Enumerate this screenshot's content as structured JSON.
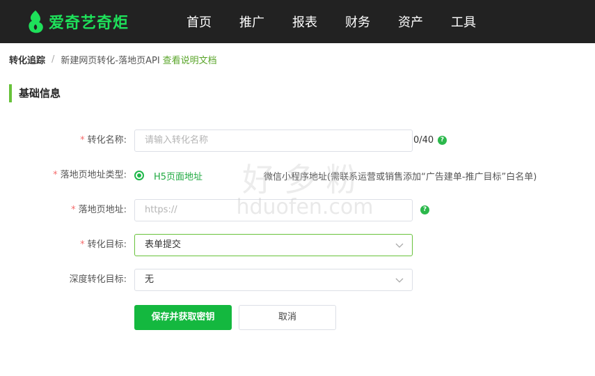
{
  "header": {
    "brand": "爱奇艺奇炬",
    "nav": [
      "首页",
      "推广",
      "报表",
      "财务",
      "资产",
      "工具"
    ]
  },
  "breadcrumb": {
    "root": "转化追踪",
    "separator": "/",
    "current": "新建网页转化-落地页API",
    "doc_link": "查看说明文档"
  },
  "section": {
    "title": "基础信息"
  },
  "form": {
    "name": {
      "label": "转化名称:",
      "placeholder": "请输入转化名称",
      "counter": "0/40"
    },
    "landing_type": {
      "label": "落地页地址类型:",
      "selected": "H5页面地址",
      "other": "微信小程序地址(需联系运营或销售添加“广告建单-推广目标”白名单)"
    },
    "landing_url": {
      "label": "落地页地址:",
      "placeholder": "https://"
    },
    "goal": {
      "label": "转化目标:",
      "value": "表单提交"
    },
    "deep_goal": {
      "label": "深度转化目标:",
      "value": "无"
    },
    "required_mark": "*",
    "help_glyph": "?"
  },
  "actions": {
    "save": "保存并获取密钥",
    "cancel": "取消"
  },
  "watermark": {
    "cn": "好多粉",
    "en": "hduofen.com"
  },
  "colors": {
    "accent": "#14b83f",
    "brand": "#1ee05a",
    "required": "#f56c6c",
    "link": "#5aa52a"
  }
}
